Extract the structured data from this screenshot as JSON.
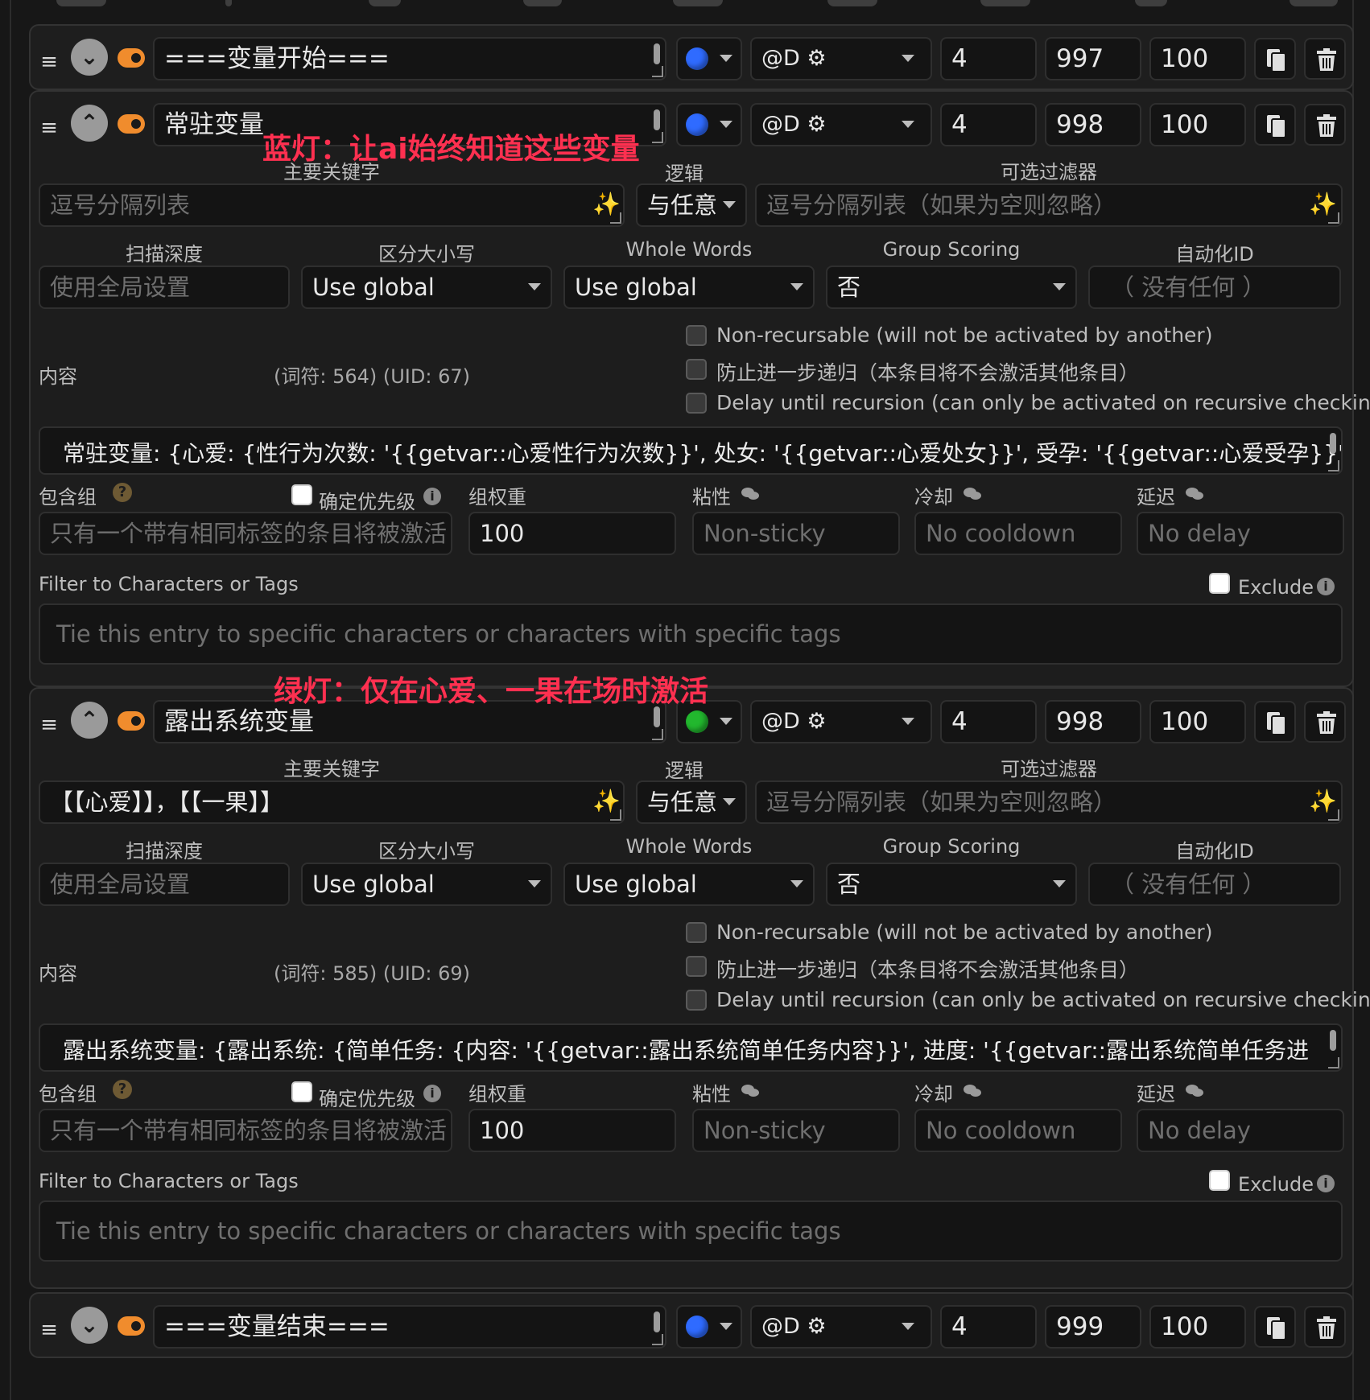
{
  "colors": {
    "accent_orange": "#f08c2d",
    "blue_lamp": "#2f6bff",
    "green_lamp": "#22b82e",
    "annotation_red": "#ff3050"
  },
  "annotations": {
    "blue": "蓝灯：让ai始终知道这些变量",
    "green": "绿灯：仅在心爱、一果在场时激活"
  },
  "entries": [
    {
      "title": "===变量开始===",
      "lamp": "blue",
      "position": "@D ⚙",
      "depth": "4",
      "order": "997",
      "probability": "100",
      "expanded": false
    },
    {
      "title": "常驻变量",
      "lamp": "blue",
      "position": "@D ⚙",
      "depth": "4",
      "order": "998",
      "probability": "100",
      "expanded": true,
      "labels": {
        "primary_keywords": "主要关键字",
        "logic": "逻辑",
        "optional_filter": "可选过滤器",
        "scan_depth": "扫描深度",
        "case_sensitive": "区分大小写",
        "whole_words": "Whole Words",
        "group_scoring": "Group Scoring",
        "automation_id": "自动化ID",
        "content": "内容",
        "token_info": "(词符:    564)  (UID: 67)",
        "inclusion_group": "包含组",
        "prioritize": "确定优先级",
        "group_weight": "组权重",
        "sticky": "粘性",
        "cooldown": "冷却",
        "delay": "延迟",
        "filter_chars": "Filter to Characters or Tags",
        "exclude": "Exclude"
      },
      "primary_keywords_value": "",
      "primary_keywords_placeholder": "逗号分隔列表",
      "logic_value": "与任意",
      "optional_filter_placeholder": "逗号分隔列表（如果为空则忽略）",
      "scan_depth_placeholder": "使用全局设置",
      "case_sensitive_value": "Use global",
      "whole_words_value": "Use global",
      "group_scoring_value": "否",
      "automation_id_placeholder": "（ 没有任何 ）",
      "checkboxes": [
        "Non-recursable (will not be activated by another)",
        "防止进一步递归（本条目将不会激活其他条目）",
        "Delay until recursion (can only be activated on recursive checking)"
      ],
      "content_text": "常驻变量: {心爱: {性行为次数: '{{getvar::心爱性行为次数}}', 处女: '{{getvar::心爱处女}}', 受孕: '{{getvar::心爱受孕}}',",
      "inclusion_group_placeholder": "只有一个带有相同标签的条目将被激活",
      "group_weight_value": "100",
      "sticky_placeholder": "Non-sticky",
      "cooldown_placeholder": "No cooldown",
      "delay_placeholder": "No delay",
      "filter_placeholder": "Tie this entry to specific characters or characters with specific tags"
    },
    {
      "title": "露出系统变量",
      "lamp": "green",
      "position": "@D ⚙",
      "depth": "4",
      "order": "998",
      "probability": "100",
      "expanded": true,
      "labels": {
        "primary_keywords": "主要关键字",
        "logic": "逻辑",
        "optional_filter": "可选过滤器",
        "scan_depth": "扫描深度",
        "case_sensitive": "区分大小写",
        "whole_words": "Whole Words",
        "group_scoring": "Group Scoring",
        "automation_id": "自动化ID",
        "content": "内容",
        "token_info": "(词符:    585)  (UID: 69)",
        "inclusion_group": "包含组",
        "prioritize": "确定优先级",
        "group_weight": "组权重",
        "sticky": "粘性",
        "cooldown": "冷却",
        "delay": "延迟",
        "filter_chars": "Filter to Characters or Tags",
        "exclude": "Exclude"
      },
      "primary_keywords_value": "【【心爱】】，【【一果】】",
      "primary_keywords_placeholder": "",
      "logic_value": "与任意",
      "optional_filter_placeholder": "逗号分隔列表（如果为空则忽略）",
      "scan_depth_placeholder": "使用全局设置",
      "case_sensitive_value": "Use global",
      "whole_words_value": "Use global",
      "group_scoring_value": "否",
      "automation_id_placeholder": "（ 没有任何 ）",
      "checkboxes": [
        "Non-recursable (will not be activated by another)",
        "防止进一步递归（本条目将不会激活其他条目）",
        "Delay until recursion (can only be activated on recursive checking)"
      ],
      "content_text": "露出系统变量: {露出系统: {简单任务: {内容: '{{getvar::露出系统简单任务内容}}', 进度: '{{getvar::露出系统简单任务进",
      "inclusion_group_placeholder": "只有一个带有相同标签的条目将被激活",
      "group_weight_value": "100",
      "sticky_placeholder": "Non-sticky",
      "cooldown_placeholder": "No cooldown",
      "delay_placeholder": "No delay",
      "filter_placeholder": "Tie this entry to specific characters or characters with specific tags"
    },
    {
      "title": "===变量结束===",
      "lamp": "blue",
      "position": "@D ⚙",
      "depth": "4",
      "order": "999",
      "probability": "100",
      "expanded": false
    }
  ]
}
